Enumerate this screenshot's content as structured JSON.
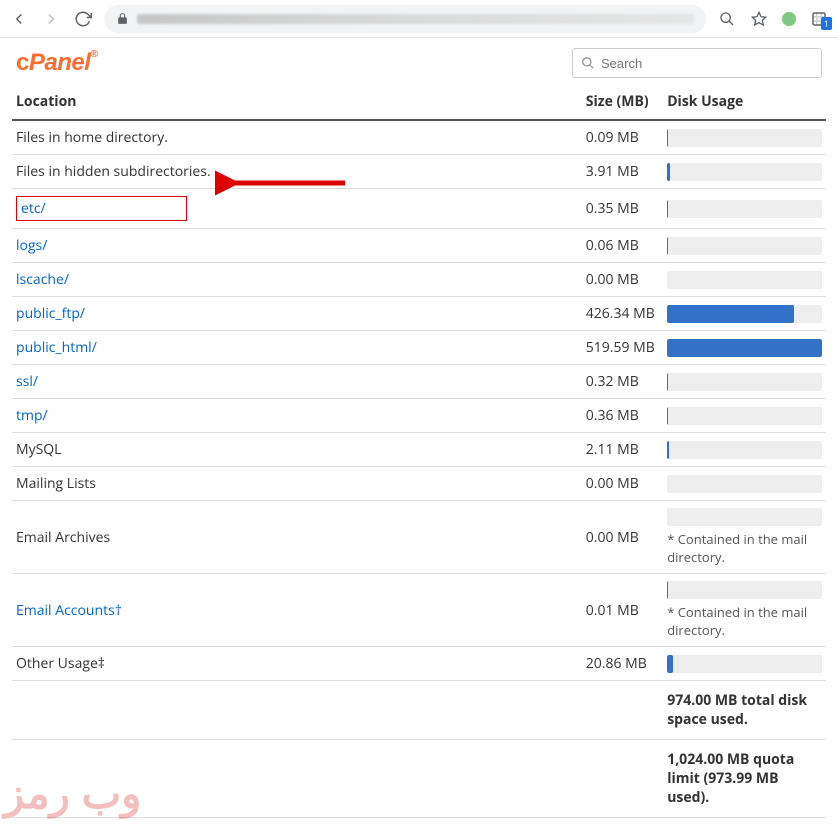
{
  "browser": {
    "ext_badge": "1"
  },
  "search": {
    "placeholder": "Search"
  },
  "headers": {
    "location": "Location",
    "size": "Size (MB)",
    "usage": "Disk Usage"
  },
  "rows": [
    {
      "label": "Files in home directory.",
      "link": false,
      "size": "0.09 MB",
      "pct": 0.5,
      "note": null,
      "highlight": false
    },
    {
      "label": "Files in hidden subdirectories.",
      "link": false,
      "size": "3.91 MB",
      "pct": 2,
      "note": null,
      "highlight": false
    },
    {
      "label": "etc/",
      "link": true,
      "size": "0.35 MB",
      "pct": 0.5,
      "note": null,
      "highlight": true
    },
    {
      "label": "logs/",
      "link": true,
      "size": "0.06 MB",
      "pct": 0.5,
      "note": null,
      "highlight": false
    },
    {
      "label": "lscache/",
      "link": true,
      "size": "0.00 MB",
      "pct": 0,
      "note": null,
      "highlight": false
    },
    {
      "label": "public_ftp/",
      "link": true,
      "size": "426.34 MB",
      "pct": 82,
      "note": null,
      "highlight": false
    },
    {
      "label": "public_html/",
      "link": true,
      "size": "519.59 MB",
      "pct": 100,
      "note": null,
      "highlight": false
    },
    {
      "label": "ssl/",
      "link": true,
      "size": "0.32 MB",
      "pct": 0.5,
      "note": null,
      "highlight": false
    },
    {
      "label": "tmp/",
      "link": true,
      "size": "0.36 MB",
      "pct": 0.5,
      "note": null,
      "highlight": false
    },
    {
      "label": "MySQL",
      "link": false,
      "size": "2.11 MB",
      "pct": 1,
      "note": null,
      "highlight": false
    },
    {
      "label": "Mailing Lists",
      "link": false,
      "size": "0.00 MB",
      "pct": 0,
      "note": null,
      "highlight": false
    },
    {
      "label": "Email Archives",
      "link": false,
      "size": "0.00 MB",
      "pct": 0,
      "note": "* Contained in the mail directory.",
      "highlight": false
    },
    {
      "label": "Email Accounts†",
      "link": true,
      "size": "0.01 MB",
      "pct": 0.5,
      "note": "* Contained in the mail directory.",
      "highlight": false
    },
    {
      "label": "Other Usage‡",
      "link": false,
      "size": "20.86 MB",
      "pct": 4,
      "note": null,
      "highlight": false
    }
  ],
  "summary": {
    "total": "974.00 MB total disk space used.",
    "quota": "1,024.00 MB quota limit (973.99 MB used)."
  },
  "watermark": "وب رمز"
}
